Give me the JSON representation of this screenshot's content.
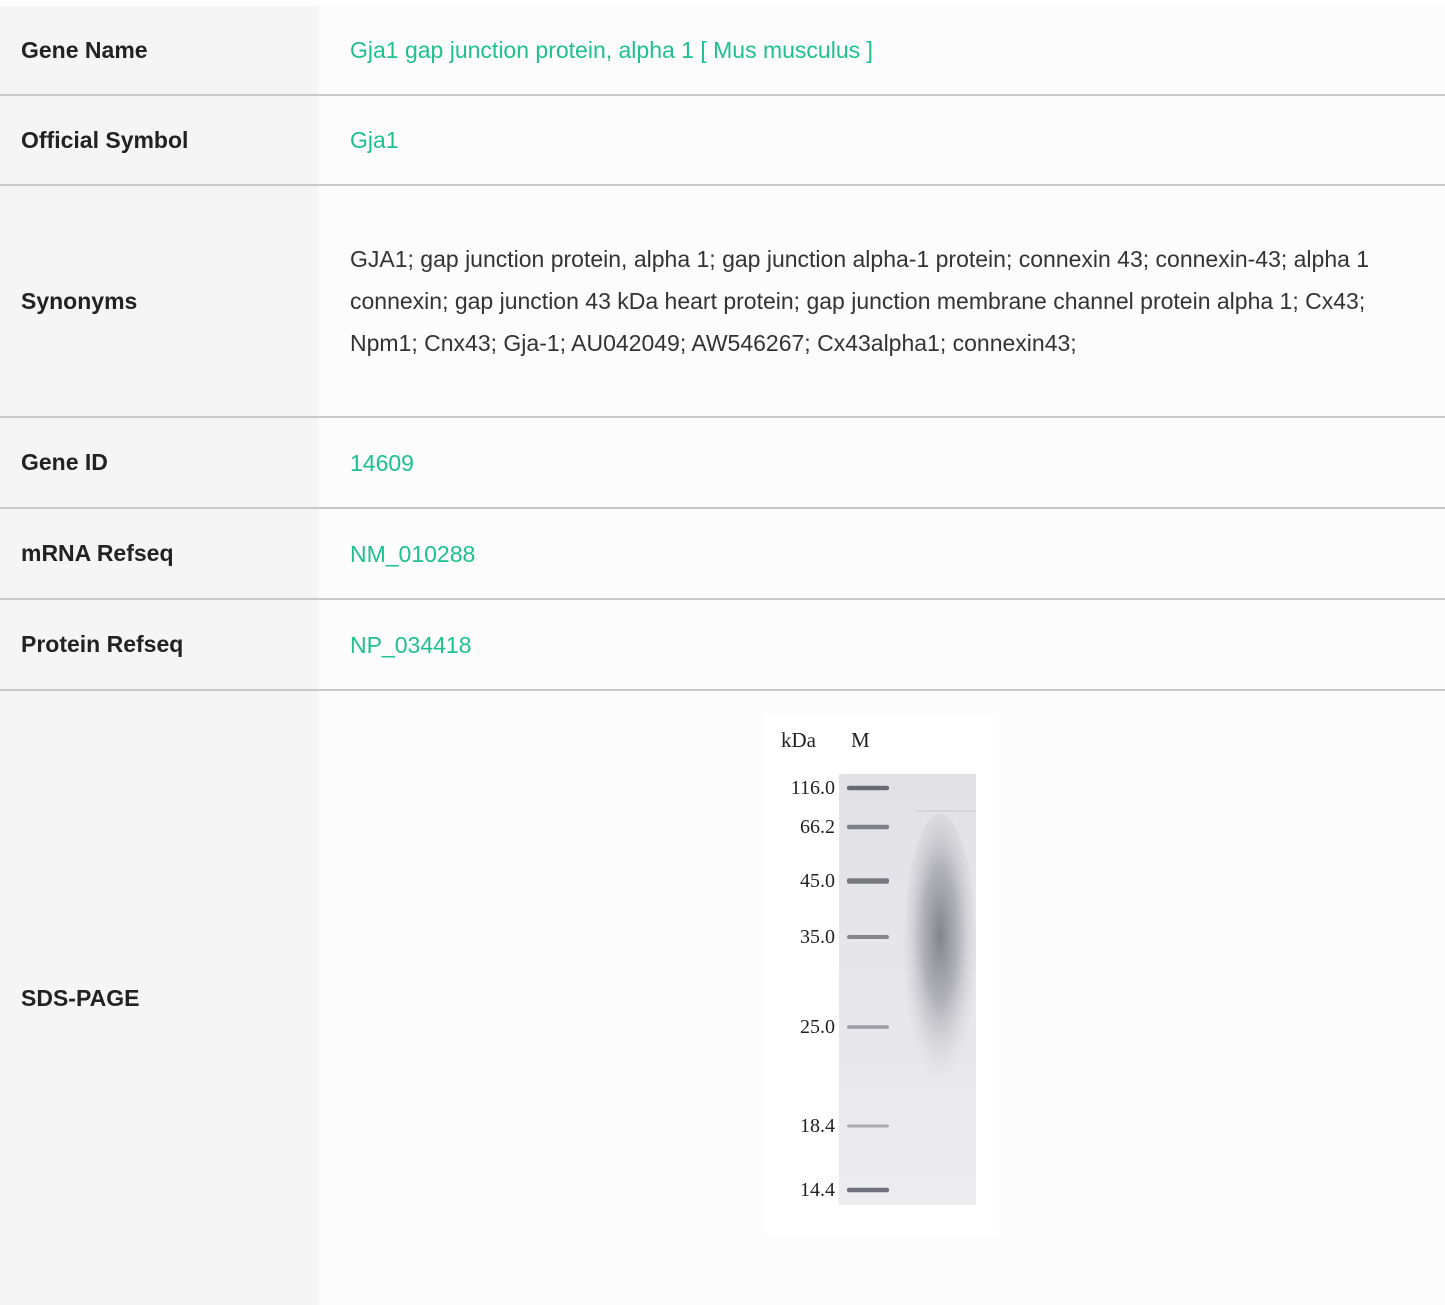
{
  "rows": [
    {
      "label": "Gene Name",
      "value": "Gja1 gap junction protein, alpha 1 [ Mus musculus ]",
      "link": true
    },
    {
      "label": "Official Symbol",
      "value": "Gja1",
      "link": true
    },
    {
      "label": "Synonyms",
      "value": "GJA1; gap junction protein, alpha 1; gap junction alpha-1 protein; connexin 43; connexin-43; alpha 1 connexin; gap junction 43 kDa heart protein; gap junction membrane channel protein alpha 1; Cx43; Npm1; Cnx43; Gja-1; AU042049; AW546267; Cx43alpha1; connexin43;",
      "link": false
    },
    {
      "label": "Gene ID",
      "value": "14609",
      "link": true
    },
    {
      "label": "mRNA Refseq",
      "value": "NM_010288",
      "link": true
    },
    {
      "label": "Protein Refseq",
      "value": "NP_034418",
      "link": true
    },
    {
      "label": "SDS-PAGE"
    }
  ],
  "gel": {
    "unit_label": "kDa",
    "lane_label": "M",
    "markers": [
      {
        "kda": "116.0",
        "value": 116.0
      },
      {
        "kda": "66.2",
        "value": 66.2
      },
      {
        "kda": "45.0",
        "value": 45.0
      },
      {
        "kda": "35.0",
        "value": 35.0
      },
      {
        "kda": "25.0",
        "value": 25.0
      },
      {
        "kda": "18.4",
        "value": 18.4
      },
      {
        "kda": "14.4",
        "value": 14.4
      }
    ]
  },
  "colors": {
    "link": "#1ec08f",
    "label_bg": "#f5f5f5",
    "border": "#c8c8c8"
  }
}
